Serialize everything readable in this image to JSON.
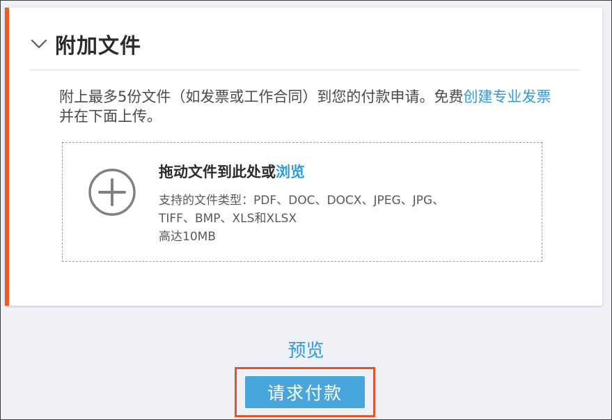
{
  "section": {
    "title": "附加文件",
    "chevron_icon": "chevron-down-icon"
  },
  "description": {
    "text_before_link": "附上最多5份文件（如发票或工作合同）到您的付款申请。免费",
    "link_text": "创建专业发票",
    "text_after_link": "并在下面上传。"
  },
  "dropzone": {
    "icon": "plus-circle-icon",
    "main_text": "拖动文件到此处或",
    "browse_link": "浏览",
    "supported_types_line1": "支持的文件类型：PDF、DOC、DOCX、JPEG、JPG、",
    "supported_types_line2": "TIFF、BMP、XLS和XLSX",
    "size_limit": "高达10MB"
  },
  "actions": {
    "preview_label": "预览",
    "submit_label": "请求付款"
  },
  "colors": {
    "accent": "#f05a24",
    "link": "#2f9bdc",
    "button": "#48a6dc",
    "highlight": "#e2542a",
    "background": "#eef0f6"
  }
}
